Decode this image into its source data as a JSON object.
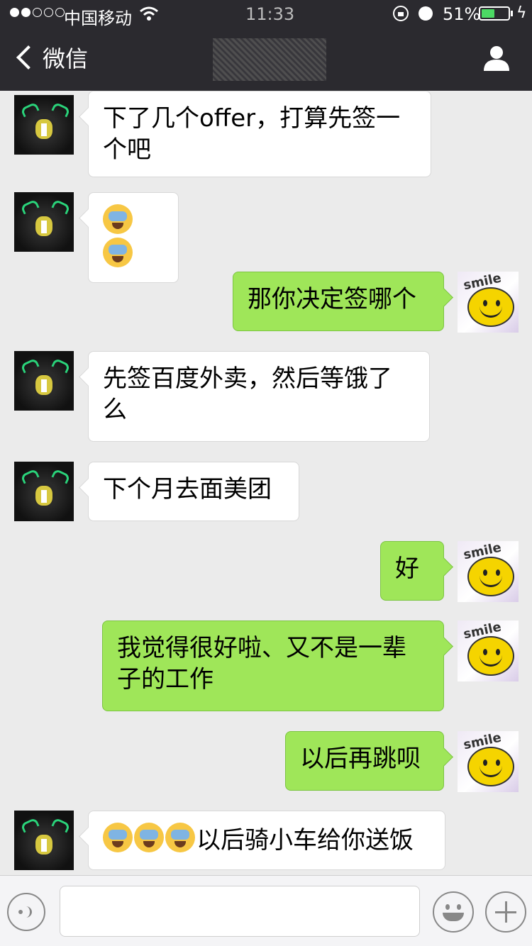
{
  "status_bar": {
    "carrier": "中国移动",
    "time": "11:33",
    "battery_pct_text": "51%",
    "battery_level": 0.51,
    "signal_bars_filled": 2,
    "signal_bars_total": 5,
    "battery_color": "#4cd964"
  },
  "nav": {
    "back_label": "微信",
    "title": "",
    "right_icon": "person-icon"
  },
  "messages": [
    {
      "side": "in",
      "text": "下了几个offer，打算先签一个吧",
      "emoji_count": 0
    },
    {
      "side": "in",
      "text": "",
      "emoji_count": 2
    },
    {
      "side": "out",
      "text": "那你决定签哪个",
      "emoji_count": 0
    },
    {
      "side": "in",
      "text": "先签百度外卖，然后等饿了么",
      "emoji_count": 0
    },
    {
      "side": "in",
      "text": "下个月去面美团",
      "emoji_count": 0
    },
    {
      "side": "out",
      "text": "好",
      "emoji_count": 0
    },
    {
      "side": "out",
      "text": "我觉得很好啦、又不是一辈子的工作",
      "emoji_count": 0
    },
    {
      "side": "out",
      "text": "以后再跳呗",
      "emoji_count": 0
    },
    {
      "side": "in",
      "text": "以后骑小车给你送饭",
      "emoji_count": 3
    }
  ],
  "avatar_me_label": "smile",
  "input_bar": {
    "voice_icon": "voice-icon",
    "emoji_icon": "emoji-icon",
    "plus_icon": "plus-icon",
    "placeholder": ""
  },
  "colors": {
    "bubble_out": "#9fe659",
    "bubble_in": "#ffffff",
    "nav_bg": "#2b2a2f",
    "chat_bg": "#ebebeb"
  }
}
